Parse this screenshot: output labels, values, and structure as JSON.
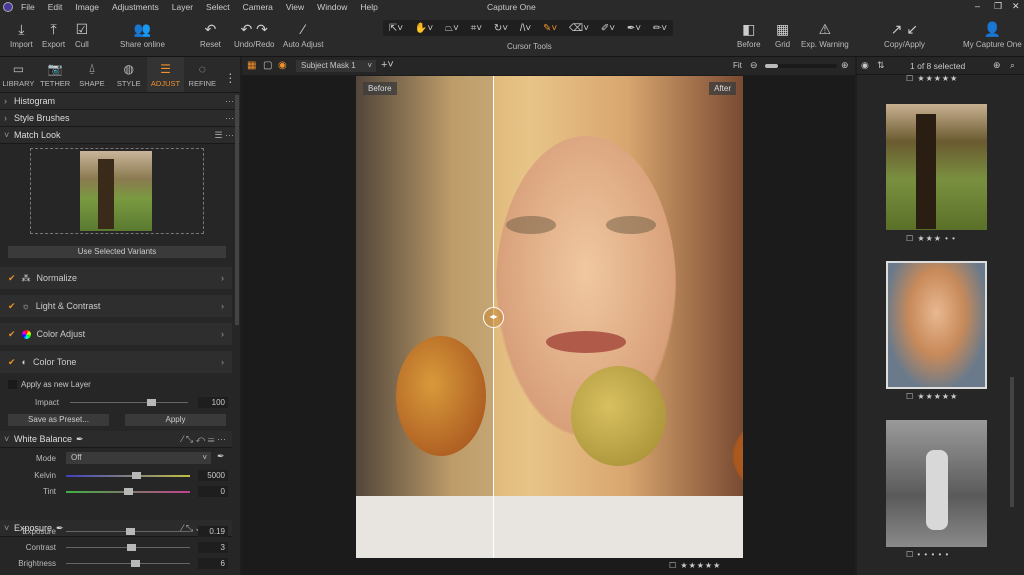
{
  "menu": [
    "File",
    "Edit",
    "Image",
    "Adjustments",
    "Layer",
    "Select",
    "Camera",
    "View",
    "Window",
    "Help"
  ],
  "title": "Capture One",
  "window_controls": [
    "–",
    "❐",
    "✕"
  ],
  "toolbar": {
    "import": "Import",
    "export": "Export",
    "cull": "Cull",
    "share": "Share online",
    "reset": "Reset",
    "undo": "Undo/Redo",
    "auto": "Auto Adjust",
    "cursor": "Cursor Tools",
    "before": "Before",
    "grid": "Grid",
    "exp": "Exp. Warning",
    "copy": "Copy/Apply",
    "account": "My Capture One"
  },
  "tabs": [
    {
      "label": "LIBRARY",
      "icon": "folder"
    },
    {
      "label": "TETHER",
      "icon": "camera"
    },
    {
      "label": "SHAPE",
      "icon": "shape"
    },
    {
      "label": "STYLE",
      "icon": "style"
    },
    {
      "label": "ADJUST",
      "icon": "sliders"
    },
    {
      "label": "REFINE",
      "icon": "refine"
    }
  ],
  "sections": {
    "histogram": "Histogram",
    "style_brushes": "Style Brushes",
    "match_look": "Match Look"
  },
  "match": {
    "use_selected": "Use Selected Variants",
    "items": [
      "Normalize",
      "Light & Contrast",
      "Color Adjust",
      "Color Tone"
    ],
    "apply_layer": "Apply as new Layer",
    "impact_label": "Impact",
    "impact": "100",
    "impact_value": 100,
    "save_preset": "Save as Preset...",
    "apply": "Apply"
  },
  "white_balance": {
    "title": "White Balance",
    "mode_label": "Mode",
    "mode": "Off",
    "kelvin_label": "Kelvin",
    "kelvin": "5000",
    "tint_label": "Tint",
    "tint": "0"
  },
  "exposure": {
    "title": "Exposure",
    "exposure_label": "Exposure",
    "exposure": "0.19",
    "contrast_label": "Contrast",
    "contrast": "3",
    "brightness_label": "Brightness",
    "brightness": "6"
  },
  "viewer": {
    "mask": "Subject Mask 1",
    "fit": "Fit",
    "before": "Before",
    "after": "After",
    "rating": "☐ ★★★★★"
  },
  "browser": {
    "selected": "1 of 8 selected",
    "ratings": [
      "☐ ★★★★★",
      "☐ ★★★ • •",
      "☐ ★★★★★",
      "☐ • • • • •"
    ]
  }
}
